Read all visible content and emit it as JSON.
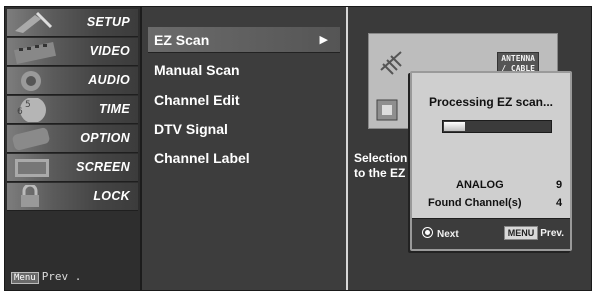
{
  "categories": [
    {
      "label": "SETUP"
    },
    {
      "label": "VIDEO"
    },
    {
      "label": "AUDIO"
    },
    {
      "label": "TIME"
    },
    {
      "label": "OPTION"
    },
    {
      "label": "SCREEN"
    },
    {
      "label": "LOCK"
    }
  ],
  "footer": {
    "menu_key": "Menu",
    "prev_label": "Prev ."
  },
  "items": [
    {
      "label": "EZ Scan",
      "selected": true
    },
    {
      "label": "Manual Scan"
    },
    {
      "label": "Channel Edit"
    },
    {
      "label": "DTV Signal"
    },
    {
      "label": "Channel Label"
    }
  ],
  "preview": {
    "antenna_line1": "ANTENNA",
    "antenna_line2": "/ CABLE",
    "description": "Selection\nto the EZ"
  },
  "dialog": {
    "title": "Processing EZ scan...",
    "progress": 0.2,
    "analog_label": "ANALOG",
    "analog_value": "9",
    "found_label": "Found Channel(s)",
    "found_value": "4",
    "next_label": "Next",
    "menu_tag": "MENU",
    "prev_label": "Prev."
  },
  "colors": {
    "panel": "#3a3a3a",
    "dialog": "#cfcfcf",
    "text": "#ffffff"
  }
}
